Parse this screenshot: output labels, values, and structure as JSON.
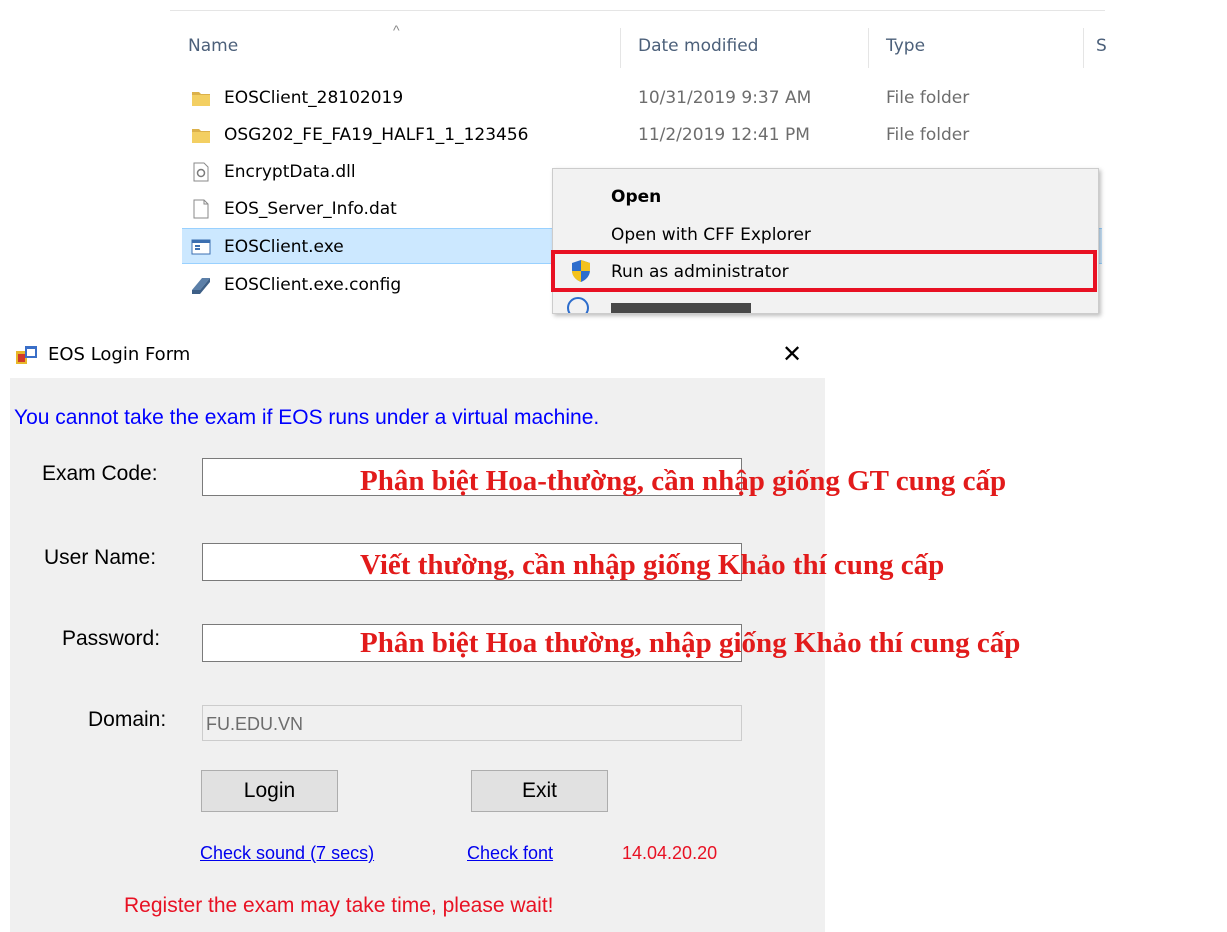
{
  "explorer": {
    "columns": {
      "name": "Name",
      "date": "Date modified",
      "type": "Type",
      "size": "S"
    },
    "files": [
      {
        "name": "EOSClient_28102019",
        "date": "10/31/2019 9:37 AM",
        "type": "File folder",
        "icon": "folder-icon"
      },
      {
        "name": "OSG202_FE_FA19_HALF1_1_123456",
        "date": "11/2/2019 12:41 PM",
        "type": "File folder",
        "icon": "folder-icon"
      },
      {
        "name": "EncryptData.dll",
        "date": "",
        "type": "",
        "icon": "dll-file-icon"
      },
      {
        "name": "EOS_Server_Info.dat",
        "date": "",
        "type": "",
        "icon": "file-icon"
      },
      {
        "name": "EOSClient.exe",
        "date": "",
        "type": "",
        "icon": "exe-app-icon",
        "selected": true
      },
      {
        "name": "EOSClient.exe.config",
        "date": "",
        "type": "",
        "icon": "config-file-icon"
      }
    ],
    "context_menu": {
      "items": [
        "Open",
        "Open with CFF Explorer",
        "Run as administrator"
      ],
      "highlight_color": "#e81123"
    }
  },
  "login_form": {
    "title": "EOS Login Form",
    "close_glyph": "✕",
    "warning": "You cannot take the exam if EOS runs under a virtual machine.",
    "labels": {
      "exam_code": "Exam Code:",
      "user_name": "User Name:",
      "password": "Password:",
      "domain": "Domain:"
    },
    "fields": {
      "exam_code": "",
      "user_name": "",
      "password": "",
      "domain": "FU.EDU.VN"
    },
    "buttons": {
      "login": "Login",
      "exit": "Exit"
    },
    "links": {
      "check_sound": "Check sound (7 secs)",
      "check_font": "Check font"
    },
    "version": "14.04.20.20",
    "status": "Register the exam may take time, please wait!",
    "colors": {
      "warning": "#0000ff",
      "version": "#e81123",
      "status": "#e81123",
      "annotation": "#e21b1b"
    }
  },
  "annotations": {
    "exam_code": "Phân biệt Hoa-thường, cần nhập giống GT cung cấp",
    "user_name": "Viết thường, cần nhập giống Khảo thí cung cấp",
    "password": "Phân biệt Hoa thường, nhập giống Khảo thí cung cấp"
  }
}
